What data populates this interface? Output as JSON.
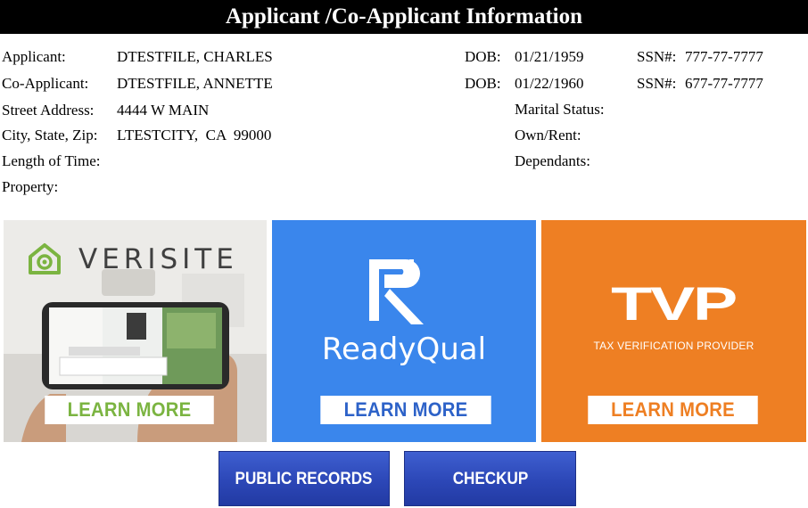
{
  "header": {
    "title": "Applicant /Co-Applicant Information"
  },
  "applicant": {
    "label": "Applicant:",
    "name": "DTESTFILE, CHARLES",
    "dob_label": "DOB:",
    "dob": "01/21/1959",
    "ssn_label": "SSN#:",
    "ssn": "777-77-7777"
  },
  "co_applicant": {
    "label": "Co-Applicant:",
    "name": "DTESTFILE, ANNETTE",
    "dob_label": "DOB:",
    "dob": "01/22/1960",
    "ssn_label": "SSN#:",
    "ssn": "677-77-7777"
  },
  "address": {
    "street_label": "Street Address:",
    "street": "4444 W MAIN",
    "city_label": "City, State, Zip:",
    "city": "LTESTCITY,  CA  99000",
    "length_label": "Length of Time:",
    "property_label": "Property:"
  },
  "details": {
    "marital_label": "Marital Status:",
    "own_rent_label": "Own/Rent:",
    "dependants_label": "Dependants:"
  },
  "tiles": {
    "verisite": {
      "logo_text": "VERISITE",
      "button": "LEARN MORE"
    },
    "readyqual": {
      "logo_text": "ReadyQual",
      "button": "LEARN MORE"
    },
    "tvp": {
      "logo_text": "TVP",
      "subtitle": "TAX VERIFICATION PROVIDER",
      "button": "LEARN MORE"
    }
  },
  "buttons": {
    "public_records": "PUBLIC RECORDS",
    "checkup": "CHECKUP"
  },
  "colors": {
    "verisite_green": "#7bb441",
    "readyqual_blue": "#3a86ec",
    "tvp_orange": "#ee7f23",
    "button_blue": "#2c47b7"
  }
}
